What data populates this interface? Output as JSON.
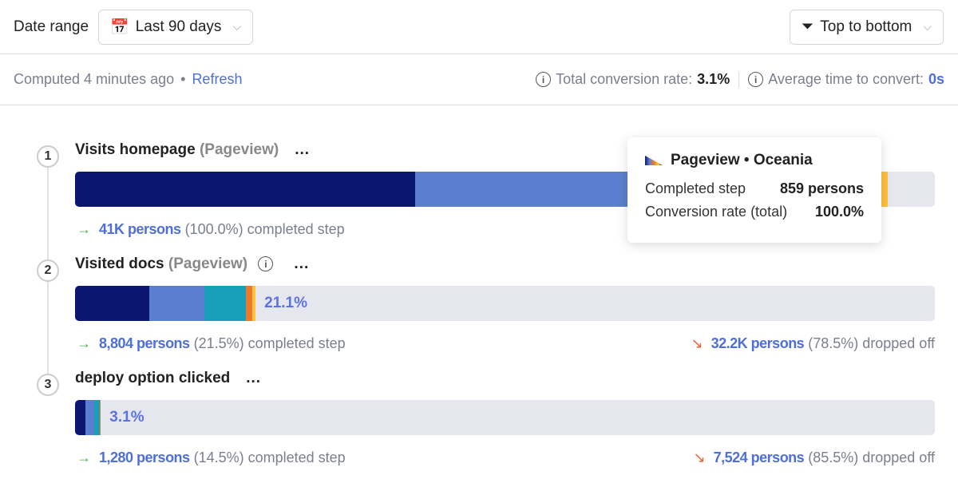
{
  "header": {
    "date_range_label": "Date range",
    "date_range_value": "Last 90 days",
    "order_value": "Top to bottom"
  },
  "info": {
    "computed": "Computed 4 minutes ago",
    "sep": "•",
    "refresh": "Refresh",
    "total_label": "Total conversion rate:",
    "total_value": "3.1%",
    "avg_label": "Average time to convert:",
    "avg_value": "0s"
  },
  "colors": {
    "navy": "#0b1670",
    "blue": "#5b7fd0",
    "teal": "#17a0b8",
    "orange": "#ec7a2b",
    "yellow": "#fdc23e",
    "track": "#e6e7ee",
    "link": "#4f6fd8"
  },
  "steps": [
    {
      "num": "1",
      "name": "Visits homepage",
      "event": "(Pageview)",
      "more": "...",
      "segments_pct": [
        39.6,
        30,
        21,
        1.9,
        2.0
      ],
      "bar_label": "",
      "completed_count": "41K persons",
      "completed_text": "(100.0%) completed step"
    },
    {
      "num": "2",
      "name": "Visited docs",
      "event": "(Pageview)",
      "more": "...",
      "segments_pct": [
        8.6,
        6.4,
        4.9,
        0.7,
        0.4
      ],
      "bar_label": "21.1%",
      "completed_count": "8,804 persons",
      "completed_text": "(21.5%) completed step",
      "dropped_count": "32.2K persons",
      "dropped_text": "(78.5%) dropped off"
    },
    {
      "num": "3",
      "name": "deploy option clicked",
      "event": "",
      "more": "...",
      "segments_pct": [
        1.2,
        1.0,
        0.7,
        0.1,
        0.0
      ],
      "bar_label": "3.1%",
      "completed_count": "1,280 persons",
      "completed_text": "(14.5%) completed step",
      "dropped_count": "7,524 persons",
      "dropped_text": "(85.5%) dropped off"
    }
  ],
  "tooltip": {
    "title": "Pageview • Oceania",
    "completed_label": "Completed step",
    "completed_value": "859 persons",
    "rate_label": "Conversion rate (total)",
    "rate_value": "100.0%"
  }
}
